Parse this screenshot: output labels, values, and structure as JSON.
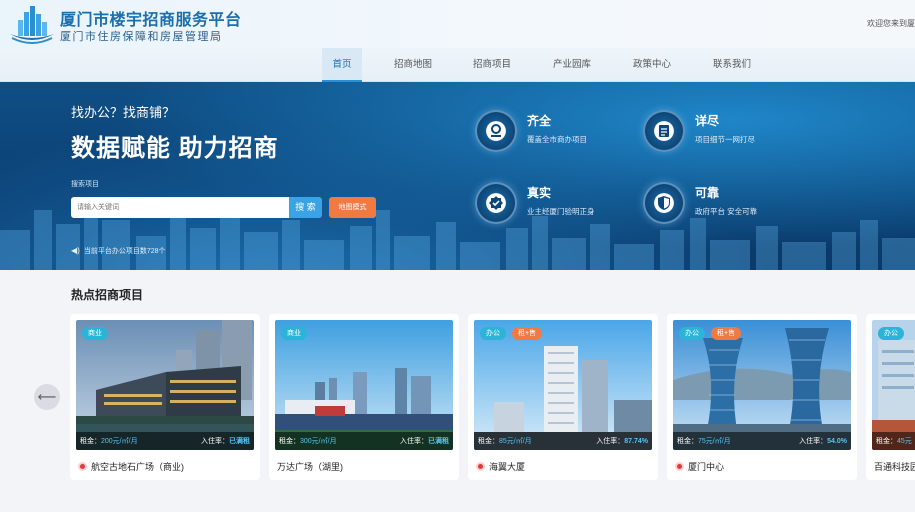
{
  "header": {
    "title": "厦门市楼宇招商服务平台",
    "subtitle": "厦门市住房保障和房屋管理局",
    "welcome": "欢迎您来到厦"
  },
  "nav": {
    "items": [
      {
        "label": "首页",
        "active": true
      },
      {
        "label": "招商地图"
      },
      {
        "label": "招商项目"
      },
      {
        "label": "产业园库"
      },
      {
        "label": "政策中心"
      },
      {
        "label": "联系我们"
      }
    ]
  },
  "hero": {
    "question": "找办公？找商铺？",
    "headline": "数据赋能 助力招商",
    "search_label": "搜索项目",
    "search_placeholder": "请输入关键词",
    "search_button": "搜 索",
    "map_button": "地图模式",
    "notice": "当前平台办公项目数728个",
    "features": [
      {
        "title": "齐全",
        "desc": "覆盖全市商办项目"
      },
      {
        "title": "详尽",
        "desc": "项目细节一网打尽"
      },
      {
        "title": "真实",
        "desc": "业主经厦门验明正身"
      },
      {
        "title": "可靠",
        "desc": "政府平台 安全可靠"
      }
    ]
  },
  "hot": {
    "title": "热点招商项目",
    "cards": [
      {
        "type": "商业",
        "deal": "",
        "rent_label": "租金：",
        "rent": "200元/㎡/月",
        "occ_label": "入住率：",
        "occ": "已满租",
        "name": "航空古地石广场（商业)",
        "icon": true
      },
      {
        "type": "商业",
        "deal": "",
        "rent_label": "租金：",
        "rent": "300元/㎡/月",
        "occ_label": "入住率：",
        "occ": "已满租",
        "name": "万达广场（湖里)",
        "icon": false
      },
      {
        "type": "办公",
        "deal": "租+售",
        "rent_label": "租金：",
        "rent": "85元/㎡/月",
        "occ_label": "入住率：",
        "occ": "87.74%",
        "name": "海翼大厦",
        "icon": true
      },
      {
        "type": "办公",
        "deal": "租+售",
        "rent_label": "租金：",
        "rent": "75元/㎡/月",
        "occ_label": "入住率：",
        "occ": "54.0%",
        "name": "厦门中心",
        "icon": true
      },
      {
        "type": "办公",
        "deal": "",
        "rent_label": "租金：",
        "rent": "45元",
        "occ_label": "",
        "occ": "",
        "name": "百通科技园",
        "icon": false
      }
    ]
  },
  "colors": {
    "brand": "#1a6fae",
    "accent": "#3aa3e6",
    "orange": "#f07a42",
    "teal_tag": "#2bb3d8"
  }
}
